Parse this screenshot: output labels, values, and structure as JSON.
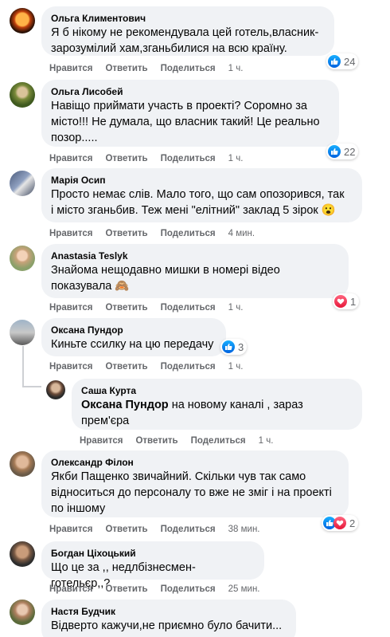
{
  "actions": {
    "like": "Нравится",
    "reply": "Ответить",
    "share": "Поделиться"
  },
  "comments": [
    {
      "author": "Ольга Климентович",
      "text": "Я б нікому не рекомендувала цей готель,власник-\nзарозумілий хам,зганьбилися на всю країну.",
      "time": "1 ч.",
      "reactions": "24"
    },
    {
      "author": "Ольга Лисобей",
      "text": "Навіщо приймати участь в проекті? Соромно за\nмісто!!! Не думала, що власник такий! Це реально\nпозор.....",
      "time": "1 ч.",
      "reactions": "22"
    },
    {
      "author": "Марія Осип",
      "text": "Просто немає слів. Мало того, що сам опозорився, так\nі місто зганьбив. Теж мені \"елітний\" заклад 5 зірок",
      "emoji": "😮",
      "time": "4 мин."
    },
    {
      "author": "Anastasia Teslyk",
      "text": "Знайома нещодавно мишки в номері відео\nпоказувала",
      "emoji": "🙈",
      "time": "1 ч.",
      "reactions": "1"
    },
    {
      "author": "Оксана Пундор",
      "text": "Киньте ссилку на цю передачу",
      "time": "1 ч.",
      "reactions": "3"
    },
    {
      "author": "Саша Курта",
      "mention": "Оксана Пундор",
      "text": " на новому каналі , зараз\nпрем'єра",
      "time": "1 ч."
    },
    {
      "author": "Олександр Філон",
      "text": "Якби Пащенко звичайний. Скільки чув так само\nвідноситься до персоналу то вже не зміг і на проекті\nпо іншому",
      "time": "38 мин.",
      "reactions": "2"
    },
    {
      "author": "Богдан Ціхоцький",
      "text": "Що це за ,, недлбізнесмен-готельєр,,?",
      "time": "25 мин."
    },
    {
      "author": "Настя Будчик",
      "text": "Відверто кажучи,не приємно було бачити..."
    }
  ],
  "colors": {
    "bubble": "#f0f2f5",
    "like": "#1877f2",
    "love": "#e61739",
    "meta": "#65676b"
  }
}
